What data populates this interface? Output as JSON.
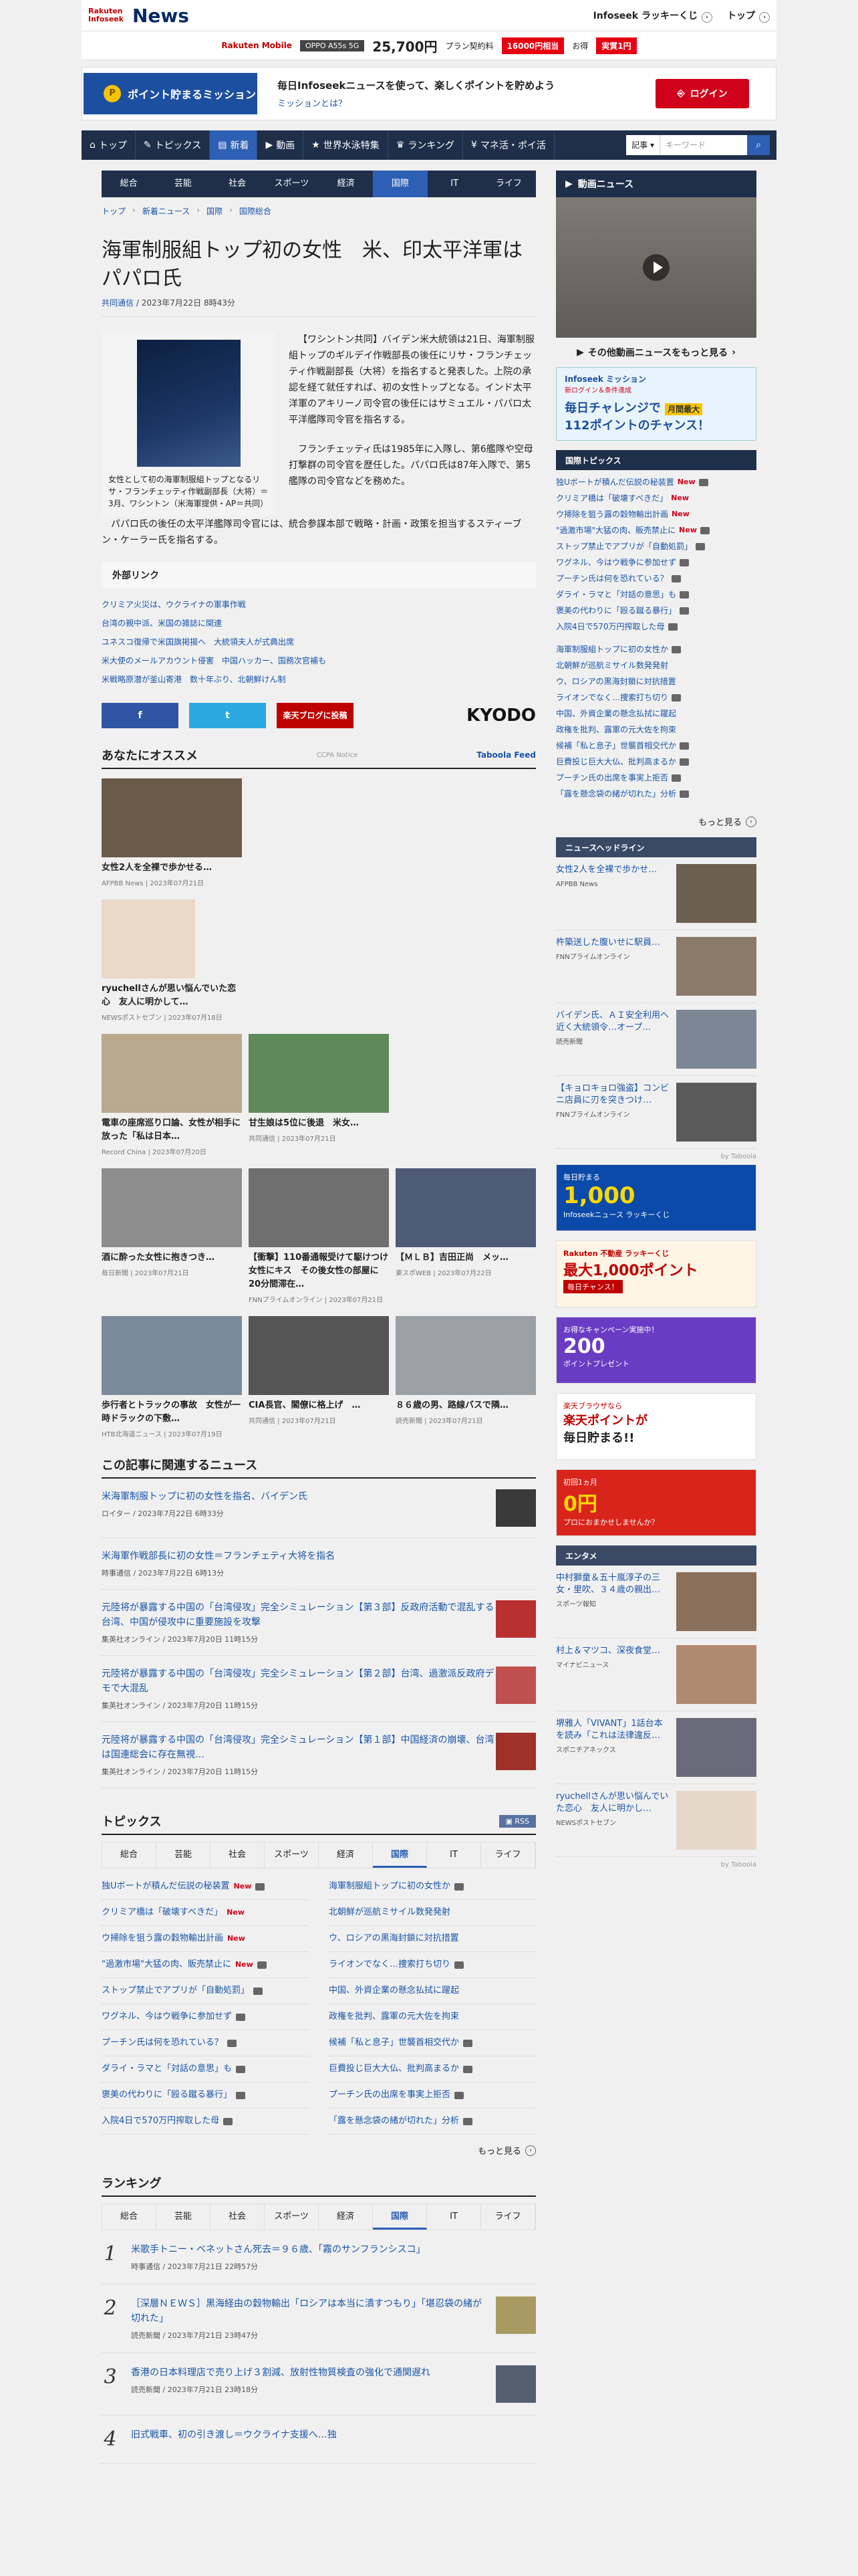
{
  "header": {
    "logo_sub": "Rakuten Infoseek",
    "logo_main": "News",
    "links": [
      "Infoseek ラッキーくじ",
      "トップ"
    ]
  },
  "adbar": {
    "brand": "Rakuten Mobile",
    "phone": "OPPO A55s 5G",
    "price": "25,700円",
    "text1": "プラン契約料",
    "red1": "16000円相当",
    "text2": "お得",
    "red2": "実質1円"
  },
  "mission": {
    "button": "ポイント貯まるミッション",
    "text": "毎日Infoseekニュースを使って、楽しくポイントを貯めよう",
    "link": "ミッションとは？",
    "login": "ログイン"
  },
  "nav": {
    "items": [
      "トップ",
      "トピックス",
      "新着",
      "動画",
      "世界水泳特集",
      "ランキング",
      "マネ活・ポイ活"
    ],
    "search_select": "記事",
    "search_placeholder": "キーワード"
  },
  "subnav": [
    "総合",
    "芸能",
    "社会",
    "スポーツ",
    "経済",
    "国際",
    "IT",
    "ライフ"
  ],
  "breadcrumb": [
    "トップ",
    "新着ニュース",
    "国際",
    "国際総合"
  ],
  "article": {
    "title": "海軍制服組トップ初の女性　米、印太平洋軍はパパロ氏",
    "source": "共同通信",
    "date": "2023年7月22日 8時43分",
    "caption": "女性として初の海軍制服組トップとなるリサ・フランチェッティ作戦副部長（大将）＝3月、ワシントン（米海軍提供・AP＝共同）",
    "p1": "【ワシントン共同】バイデン米大統領は21日、海軍制服組トップのギルデイ作戦部長の後任にリサ・フランチェッティ作戦副部長（大将）を指名すると発表した。上院の承認を経て就任すれば、初の女性トップとなる。インド太平洋軍のアキリーノ司令官の後任にはサミュエル・パパロ太平洋艦隊司令官を指名する。",
    "p2": "フランチェッティ氏は1985年に入隊し、第6艦隊や空母打撃群の司令官を歴任した。パパロ氏は87年入隊で、第5艦隊の司令官などを務めた。",
    "p3": "パパロ氏の後任の太平洋艦隊司令官には、統合参謀本部で戦略・計画・政策を担当するスティーブン・ケーラー氏を指名する。"
  },
  "external": {
    "title": "外部リンク",
    "links": [
      "クリミア火災は、ウクライナの軍事作戦",
      "台湾の親中派、米国の雑誌に関連",
      "ユネスコ復帰で米国旗掲揚へ　大統領夫人が式典出席",
      "米大使のメールアカウント侵害　中国ハッカー、国務次官補も",
      "米戦略原潜が釜山寄港　数十年ぶり、北朝鮮けん制"
    ]
  },
  "share": {
    "fb": "f",
    "tw": "t",
    "rk": "楽天ブログに投稿",
    "kyodo": "KYODO"
  },
  "recommend": {
    "title": "あなたにオススメ",
    "note": "CCPA Notice",
    "feed": "Taboola Feed",
    "cards": [
      {
        "t": "女性2人を全裸で歩かせる…",
        "s": "AFPBB News | 2023年07月21日"
      },
      {
        "t": "ryuchellさんが思い悩んでいた恋心　友人に明かして…",
        "s": "NEWSポストセブン | 2023年07月18日"
      },
      {
        "t": "電車の座席巡り口論、女性が相手に放った「私は日本…",
        "s": "Record China | 2023年07月20日"
      },
      {
        "t": "甘生娘は5位に後退　米女…",
        "s": "共同通信 | 2023年07月21日"
      },
      {
        "t": "酒に酔った女性に抱きつき…",
        "s": "毎日新聞 | 2023年07月21日"
      },
      {
        "t": "【衝撃】110番通報受けて駆けつけ女性にキス　その後女性の部屋に20分間滞在…",
        "s": "FNNプライムオンライン | 2023年07月21日"
      },
      {
        "t": "【ＭＬＢ】吉田正尚　メッ…",
        "s": "東スポWEB | 2023年07月22日"
      },
      {
        "t": "歩行者とトラックの事故　女性が一時ドラックの下敷…",
        "s": "HTB北海道ニュース | 2023年07月19日"
      },
      {
        "t": "CIA長官、閣僚に格上げ　…",
        "s": "共同通信 | 2023年07月21日"
      },
      {
        "t": "８６歳の男、路線バスで隣…",
        "s": "読売新聞 | 2023年07月21日"
      }
    ]
  },
  "related": {
    "title": "この記事に関連するニュース",
    "items": [
      {
        "t": "米海軍制服トップに初の女性を指名、バイデン氏",
        "s": "ロイター / 2023年7月22日 6時33分"
      },
      {
        "t": "米海軍作戦部長に初の女性＝フランチェティ大将を指名",
        "s": "時事通信 / 2023年7月22日 6時13分"
      },
      {
        "t": "元陸将が暴露する中国の「台湾侵攻」完全シミュレーション【第３部】反政府活動で混乱する台湾、中国が侵攻中に重要施設を攻撃",
        "s": "集英社オンライン / 2023年7月20日 11時15分"
      },
      {
        "t": "元陸将が暴露する中国の「台湾侵攻」完全シミュレーション【第２部】台湾、過激派反政府デモで大混乱",
        "s": "集英社オンライン / 2023年7月20日 11時15分"
      },
      {
        "t": "元陸将が暴露する中国の「台湾侵攻」完全シミュレーション【第１部】中国経済の崩壊、台湾は国連総会に存在無視…",
        "s": "集英社オンライン / 2023年7月20日 11時15分"
      }
    ]
  },
  "topics": {
    "title": "トピックス",
    "rss": "RSS",
    "tabs": [
      "総合",
      "芸能",
      "社会",
      "スポーツ",
      "経済",
      "国際",
      "IT",
      "ライフ"
    ],
    "left": [
      "独Uボートが積んだ伝説の秘装置",
      "クリミア橋は「破壊すべきだ」",
      "ウ掃除を狙う露の穀物輸出計画",
      "\"過激市場\"大猛の肉、販売禁止に",
      "ストップ禁止でアプリが「自動処罰」",
      "ワグネル、今はウ戦争に参加せず",
      "プーチン氏は何を恐れている？",
      "ダライ・ラマと「対話の意思」も",
      "褒美の代わりに「殴る蹴る暴行」",
      "入院4日で570万円搾取した母"
    ],
    "right": [
      "海軍制服組トップに初の女性か",
      "北朝鮮が巡航ミサイル数発発射",
      "ウ、ロシアの黒海封鎖に対抗措置",
      "ライオンでなく…捜索打ち切り",
      "中国、外資企業の懸念払拭に躍起",
      "政権を批判、露軍の元大佐を拘束",
      "候補「私と息子」世襲首相交代か",
      "巨費投じ巨大大仏、批判高まるか",
      "プーチン氏の出席を事実上拒否",
      "「露を懸念袋の緒が切れた」分析"
    ],
    "more": "もっと見る"
  },
  "ranking": {
    "title": "ランキング",
    "tabs": [
      "総合",
      "芸能",
      "社会",
      "スポーツ",
      "経済",
      "国際",
      "IT",
      "ライフ"
    ],
    "items": [
      {
        "n": "1",
        "t": "米歌手トニー・ベネットさん死去＝９６歳、「霧のサンフランシスコ」",
        "s": "時事通信 / 2023年7月21日 22時57分"
      },
      {
        "n": "2",
        "t": "［深層ＮＥＷＳ］黒海経由の穀物輸出「ロシアは本当に潰すつもり」「堪忍袋の緒が切れた」",
        "s": "読売新聞 / 2023年7月21日 23時47分"
      },
      {
        "n": "3",
        "t": "香港の日本料理店で売り上げ３割減、放射性物質検査の強化で通関遅れ",
        "s": "読売新聞 / 2023年7月21日 23時18分"
      },
      {
        "n": "4",
        "t": "旧式戦車、初の引き渡し＝ウクライナ支援へ…独",
        "s": ""
      }
    ]
  },
  "side": {
    "video_title": "動画ニュース",
    "video_link": "その他動画ニュースをもっと見る",
    "mission_banner": {
      "a": "Infoseek ミッション",
      "b": "新ログイン＆条件達成",
      "c": "毎日チャレンジで",
      "d": "月間最大",
      "e": "112ポイントのチャンス！"
    },
    "intl_title": "国際トピックス",
    "intl": [
      "独Uボートが積んだ伝説の秘装置",
      "クリミア橋は「破壊すべきだ」",
      "ウ掃除を狙う露の穀物輸出計画",
      "\"過激市場\"大猛の肉、販売禁止に",
      "ストップ禁止でアプリが「自動処罰」",
      "ワグネル、今はウ戦争に参加せず",
      "プーチン氏は何を恐れている？",
      "ダライ・ラマと「対話の意思」も",
      "褒美の代わりに「殴る蹴る暴行」",
      "入院4日で570万円搾取した母",
      "海軍制服組トップに初の女性か",
      "北朝鮮が巡航ミサイル数発発射",
      "ウ、ロシアの黒海封鎖に対抗措置",
      "ライオンでなく…捜索打ち切り",
      "中国、外資企業の懸念払拭に躍起",
      "政権を批判、露軍の元大佐を拘束",
      "候補「私と息子」世襲首相交代か",
      "巨費投じ巨大大仏、批判高まるか",
      "プーチン氏の出席を事実上拒否",
      "「露を懸念袋の緒が切れた」分析"
    ],
    "more": "もっと見る",
    "headline_title": "ニュースヘッドライン",
    "headlines": [
      {
        "t": "女性2人を全裸で歩かせ…",
        "s": "AFPBB News"
      },
      {
        "t": "杵築送した腹いせに駅員…",
        "s": "FNNプライムオンライン"
      },
      {
        "t": "バイデン氏、ＡＩ安全利用へ近く大統領令…オープ…",
        "s": "読売新聞"
      },
      {
        "t": "【キョロキョロ強盗】コンビニ店員に刃を突きつけ…",
        "s": "FNNプライムオンライン"
      }
    ],
    "by": "by Taboola",
    "ads": [
      {
        "a": "毎日貯まる",
        "b": "1,000",
        "c": "Infoseekニュース ラッキーくじ"
      },
      {
        "a": "Rakuten 不動産 ラッキーくじ",
        "b": "最大1,000ポイント",
        "c": "毎日チャンス！"
      },
      {
        "a": "お得なキャンペーン実施中！",
        "b": "200",
        "c": "ポイントプレゼント"
      },
      {
        "a": "楽天ブラウザなら",
        "b": "楽天ポイントが",
        "c": "毎日貯まる!!"
      },
      {
        "a": "初回1ヵ月",
        "b": "0円",
        "c": "プロにおまかせしませんか？"
      }
    ],
    "ent_title": "エンタメ",
    "ent": [
      {
        "t": "中村獅童＆五十嵐淳子の三女・里吹、３４歳の親出…",
        "s": "スポーツ報知"
      },
      {
        "t": "村上＆マツコ、深夜食堂…",
        "s": "マイナビニュース"
      },
      {
        "t": "堺雅人「VIVANT」1話台本を読み「これは法律違反…",
        "s": "スポニチアネックス"
      },
      {
        "t": "ryuchellさんが思い悩んでいた恋心　友人に明かし…",
        "s": "NEWSポストセブン"
      }
    ],
    "by2": "by Taboola"
  }
}
